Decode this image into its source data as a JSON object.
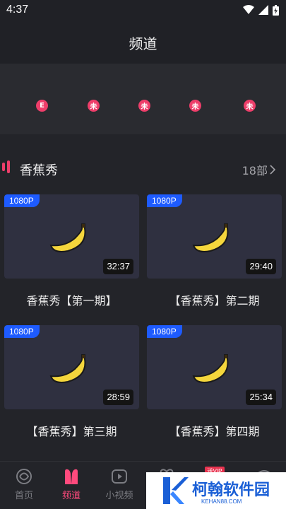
{
  "status_bar": {
    "time": "4:37"
  },
  "header": {
    "title": "频道"
  },
  "categories": [
    {
      "glyph": "E",
      "color": "#ee3e6a"
    },
    {
      "glyph": "未",
      "color": "#ee3e6a"
    },
    {
      "glyph": "未",
      "color": "#ee3e6a"
    },
    {
      "glyph": "未",
      "color": "#ee3e6a"
    },
    {
      "glyph": "未",
      "color": "#ee3e6a"
    }
  ],
  "section": {
    "title": "香蕉秀",
    "more": "18部"
  },
  "videos": [
    {
      "quality": "1080P",
      "duration": "32:37",
      "title": "香蕉秀【第一期】"
    },
    {
      "quality": "1080P",
      "duration": "29:40",
      "title": "【香蕉秀】第二期"
    },
    {
      "quality": "1080P",
      "duration": "28:59",
      "title": "【香蕉秀】第三期"
    },
    {
      "quality": "1080P",
      "duration": "25:34",
      "title": "【香蕉秀】第四期"
    }
  ],
  "tabbar": {
    "tabs": [
      {
        "label": "首页",
        "active": false,
        "icon": "home-swirl-icon"
      },
      {
        "label": "频道",
        "active": true,
        "icon": "channel-icon"
      },
      {
        "label": "小视频",
        "active": false,
        "icon": "short-video-icon"
      }
    ],
    "vip_tag": "送VIP"
  },
  "watermark": {
    "brand": "柯翰软件园",
    "site": "KEHAN88.COM"
  },
  "colors": {
    "accent": "#ff4a7d",
    "badge": "#1e5bff",
    "background": "#232429"
  }
}
